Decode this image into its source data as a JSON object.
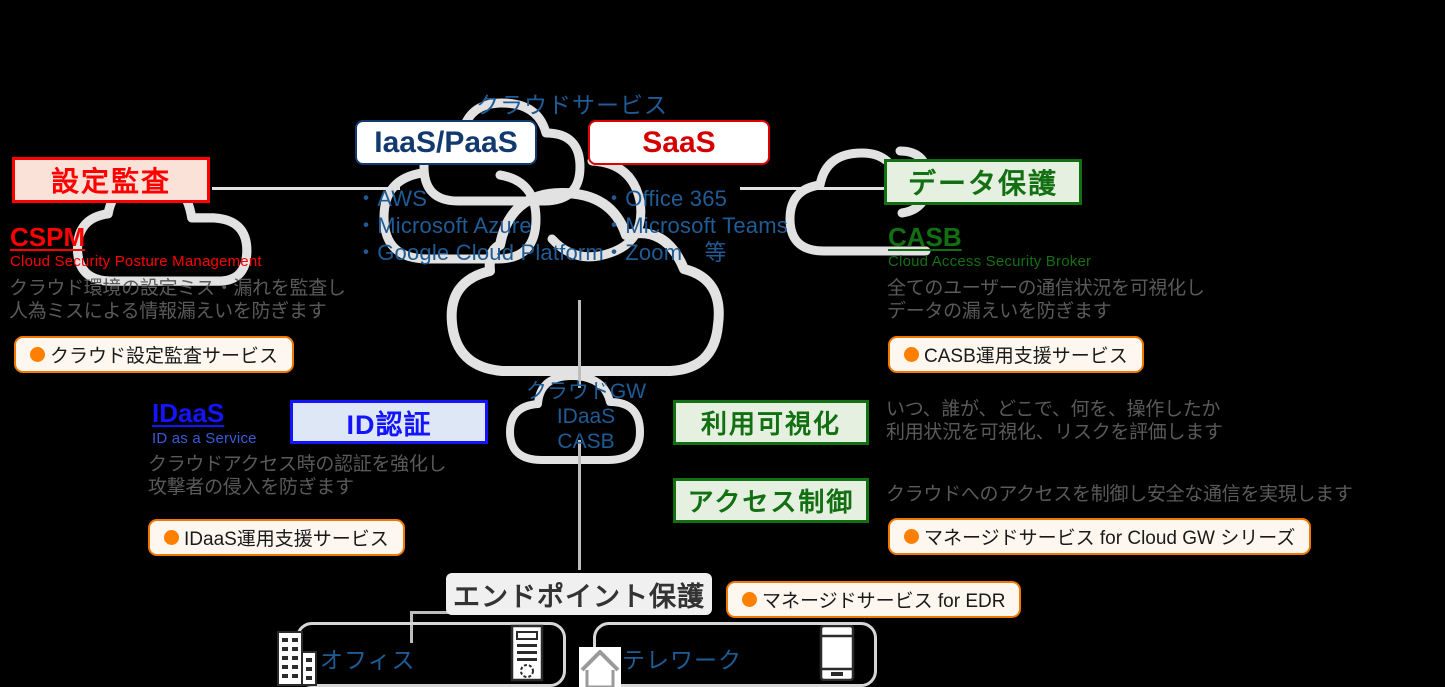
{
  "colors": {
    "red": "#ff0000",
    "green": "#127012",
    "blue": "#1414ff",
    "navy": "#123a6e",
    "link_blue": "#1f5c96",
    "orange": "#ff8000",
    "gray_text": "#5a5a5a",
    "cloud_gray": "#e2e2e2"
  },
  "cloud_service": {
    "title": "クラウドサービス",
    "iaas_label": "IaaS/PaaS",
    "saas_label": "SaaS",
    "iaas_items": "・AWS\n・Microsoft Azure\n・Google Cloud Platform",
    "saas_items": "・Office 365\n・Microsoft Teams\n・Zoom　等"
  },
  "cspm": {
    "box_label": "設定監査",
    "acronym": "CSPM",
    "expansion": "Cloud Security Posture Management",
    "description": "クラウド環境の設定ミス・漏れを監査し\n人為ミスによる情報漏えいを防ぎます",
    "service": "クラウド設定監査サービス"
  },
  "casb": {
    "box_label": "データ保護",
    "acronym": "CASB",
    "expansion": "Cloud Access Security Broker",
    "description": "全てのユーザーの通信状況を可視化し\nデータの漏えいを防ぎます",
    "service": "CASB運用支援サービス"
  },
  "idaas": {
    "box_label": "ID認証",
    "acronym": "IDaaS",
    "expansion": "ID as a Service",
    "description": "クラウドアクセス時の認証を強化し\n攻撃者の侵入を防ぎます",
    "service": "IDaaS運用支援サービス"
  },
  "cloud_gw": {
    "cloud_label": "クラウドGW\nIDaaS\nCASB",
    "visualize_box": "利用可視化",
    "visualize_desc": "いつ、誰が、どこで、何を、操作したか\n利用状況を可視化、リスクを評価します",
    "access_box": "アクセス制御",
    "access_desc": "クラウドへのアクセスを制御し安全な通信を実現します",
    "service": "マネージドサービス for Cloud GW シリーズ"
  },
  "endpoint": {
    "box_label": "エンドポイント保護",
    "service": "マネージドサービス for EDR"
  },
  "locations": {
    "office": "オフィス",
    "telework": "テレワーク"
  }
}
